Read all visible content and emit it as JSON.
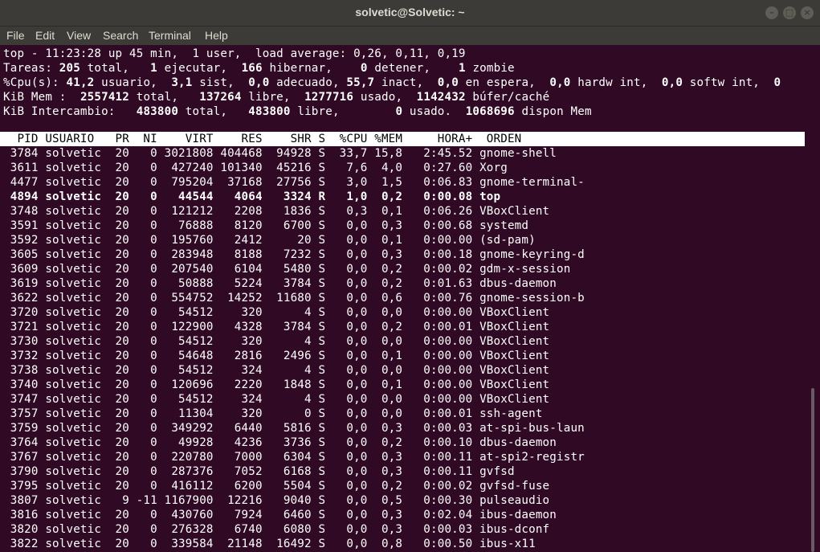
{
  "window": {
    "title": "solvetic@Solvetic: ~"
  },
  "menu": [
    "File",
    "Edit",
    "View",
    "Search",
    "Terminal",
    "Help"
  ],
  "summary": {
    "top": "top - 11:23:28 up 45 min,  1 user,  load average: 0,26, 0,11, 0,19",
    "tasks": [
      {
        "t": "Tareas: "
      },
      {
        "t": "205",
        "b": true
      },
      {
        "t": " total,   "
      },
      {
        "t": "1",
        "b": true
      },
      {
        "t": " ejecutar,  "
      },
      {
        "t": "166",
        "b": true
      },
      {
        "t": " hibernar,    "
      },
      {
        "t": "0",
        "b": true
      },
      {
        "t": " detener,    "
      },
      {
        "t": "1",
        "b": true
      },
      {
        "t": " zombie"
      }
    ],
    "cpu": [
      {
        "t": "%Cpu(s): "
      },
      {
        "t": "41,2",
        "b": true
      },
      {
        "t": " usuario,  "
      },
      {
        "t": "3,1",
        "b": true
      },
      {
        "t": " sist,  "
      },
      {
        "t": "0,0",
        "b": true
      },
      {
        "t": " adecuado, "
      },
      {
        "t": "55,7",
        "b": true
      },
      {
        "t": " inact,  "
      },
      {
        "t": "0,0",
        "b": true
      },
      {
        "t": " en espera,  "
      },
      {
        "t": "0,0",
        "b": true
      },
      {
        "t": " hardw int,  "
      },
      {
        "t": "0,0",
        "b": true
      },
      {
        "t": " softw int,  "
      },
      {
        "t": "0",
        "b": true
      }
    ],
    "mem": [
      {
        "t": "KiB Mem :  "
      },
      {
        "t": "2557412",
        "b": true
      },
      {
        "t": " total,   "
      },
      {
        "t": "137264",
        "b": true
      },
      {
        "t": " libre,  "
      },
      {
        "t": "1277716",
        "b": true
      },
      {
        "t": " usado,  "
      },
      {
        "t": "1142432",
        "b": true
      },
      {
        "t": " búfer/caché"
      }
    ],
    "swap": [
      {
        "t": "KiB Intercambio:   "
      },
      {
        "t": "483800",
        "b": true
      },
      {
        "t": " total,   "
      },
      {
        "t": "483800",
        "b": true
      },
      {
        "t": " libre,        "
      },
      {
        "t": "0",
        "b": true
      },
      {
        "t": " usado.  "
      },
      {
        "t": "1068696",
        "b": true
      },
      {
        "t": " dispon Mem"
      }
    ]
  },
  "table": {
    "header": "  PID USUARIO   PR  NI    VIRT    RES    SHR S  %CPU %MEM     HORA+  ORDEN",
    "rows": [
      {
        "text": " 3784 solvetic  20   0 3021808 404468  94928 S  33,7 15,8   2:45.52 gnome-shell"
      },
      {
        "text": " 3611 solvetic  20   0  427240 101340  45216 S   7,6  4,0   0:27.60 Xorg"
      },
      {
        "text": " 4477 solvetic  20   0  795204  37168  27756 S   3,0  1,5   0:06.83 gnome-terminal-"
      },
      {
        "text": " 4894 solvetic  20   0   44544   4064   3324 R   1,0  0,2   0:00.08 top",
        "bold": true
      },
      {
        "text": " 3748 solvetic  20   0  121212   2208   1836 S   0,3  0,1   0:06.26 VBoxClient"
      },
      {
        "text": " 3591 solvetic  20   0   76888   8120   6700 S   0,0  0,3   0:00.68 systemd"
      },
      {
        "text": " 3592 solvetic  20   0  195760   2412     20 S   0,0  0,1   0:00.00 (sd-pam)"
      },
      {
        "text": " 3605 solvetic  20   0  283948   8188   7232 S   0,0  0,3   0:00.18 gnome-keyring-d"
      },
      {
        "text": " 3609 solvetic  20   0  207540   6104   5480 S   0,0  0,2   0:00.02 gdm-x-session"
      },
      {
        "text": " 3619 solvetic  20   0   50888   5224   3784 S   0,0  0,2   0:01.63 dbus-daemon"
      },
      {
        "text": " 3622 solvetic  20   0  554752  14252  11680 S   0,0  0,6   0:00.76 gnome-session-b"
      },
      {
        "text": " 3720 solvetic  20   0   54512    320      4 S   0,0  0,0   0:00.00 VBoxClient"
      },
      {
        "text": " 3721 solvetic  20   0  122900   4328   3784 S   0,0  0,2   0:00.01 VBoxClient"
      },
      {
        "text": " 3730 solvetic  20   0   54512    320      4 S   0,0  0,0   0:00.00 VBoxClient"
      },
      {
        "text": " 3732 solvetic  20   0   54648   2816   2496 S   0,0  0,1   0:00.00 VBoxClient"
      },
      {
        "text": " 3738 solvetic  20   0   54512    324      4 S   0,0  0,0   0:00.00 VBoxClient"
      },
      {
        "text": " 3740 solvetic  20   0  120696   2220   1848 S   0,0  0,1   0:00.00 VBoxClient"
      },
      {
        "text": " 3747 solvetic  20   0   54512    324      4 S   0,0  0,0   0:00.00 VBoxClient"
      },
      {
        "text": " 3757 solvetic  20   0   11304    320      0 S   0,0  0,0   0:00.01 ssh-agent"
      },
      {
        "text": " 3759 solvetic  20   0  349292   6440   5816 S   0,0  0,3   0:00.03 at-spi-bus-laun"
      },
      {
        "text": " 3764 solvetic  20   0   49928   4236   3736 S   0,0  0,2   0:00.10 dbus-daemon"
      },
      {
        "text": " 3767 solvetic  20   0  220780   7000   6304 S   0,0  0,3   0:00.11 at-spi2-registr"
      },
      {
        "text": " 3790 solvetic  20   0  287376   7052   6168 S   0,0  0,3   0:00.11 gvfsd"
      },
      {
        "text": " 3795 solvetic  20   0  416112   6200   5504 S   0,0  0,2   0:00.02 gvfsd-fuse"
      },
      {
        "text": " 3807 solvetic   9 -11 1167900  12216   9040 S   0,0  0,5   0:00.30 pulseaudio"
      },
      {
        "text": " 3816 solvetic  20   0  430760   7924   6460 S   0,0  0,3   0:02.04 ibus-daemon"
      },
      {
        "text": " 3820 solvetic  20   0  276328   6740   6080 S   0,0  0,3   0:00.03 ibus-dconf"
      },
      {
        "text": " 3822 solvetic  20   0  339584  21148  16492 S   0,0  0,8   0:00.50 ibus-x11"
      }
    ]
  }
}
